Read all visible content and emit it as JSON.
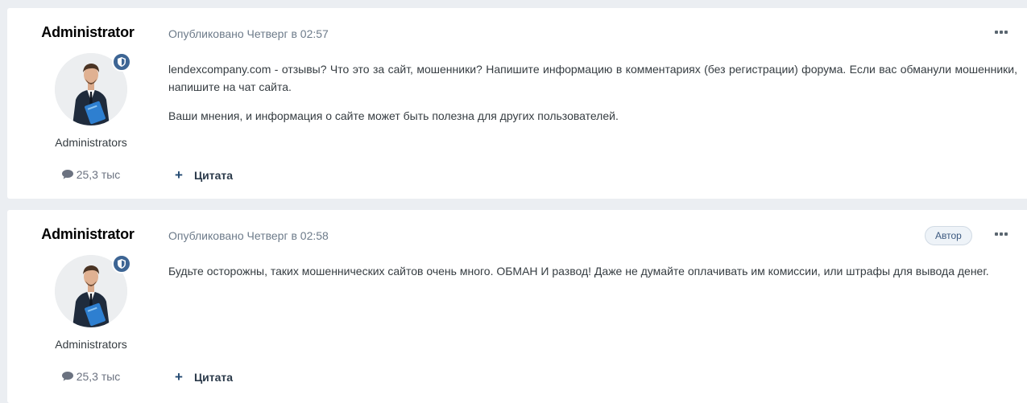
{
  "posts": [
    {
      "author": "Administrator",
      "group": "Administrators",
      "post_count": "25,3 тыс",
      "published": "Опубликовано Четверг в 02:57",
      "is_author_tag": "",
      "paragraphs": [
        "lendexcompany.com - отзывы? Что это за сайт, мошенники? Напишите информацию в комментариях (без регистрации) форума. Если вас обманули мошенники, напишите на чат сайта.",
        "Ваши мнения, и информация о сайте может быть полезна для других пользователей."
      ],
      "quote_label": "Цитата"
    },
    {
      "author": "Administrator",
      "group": "Administrators",
      "post_count": "25,3 тыс",
      "published": "Опубликовано Четверг в 02:58",
      "is_author_tag": "Автор",
      "paragraphs": [
        "Будьте осторожны, таких мошеннических сайтов очень много. ОБМАН И развод! Даже не думайте оплачивать им комиссии, или штрафы для вывода денег."
      ],
      "quote_label": "Цитата"
    }
  ],
  "icons": {
    "more": "more-horizontal-icon",
    "posts": "speech-bubble-icon",
    "badge": "shield-icon",
    "quote": "plus-icon"
  },
  "colors": {
    "background": "#ebeef2",
    "badge": "#3d6594",
    "meta_text": "#6d7b8a"
  }
}
